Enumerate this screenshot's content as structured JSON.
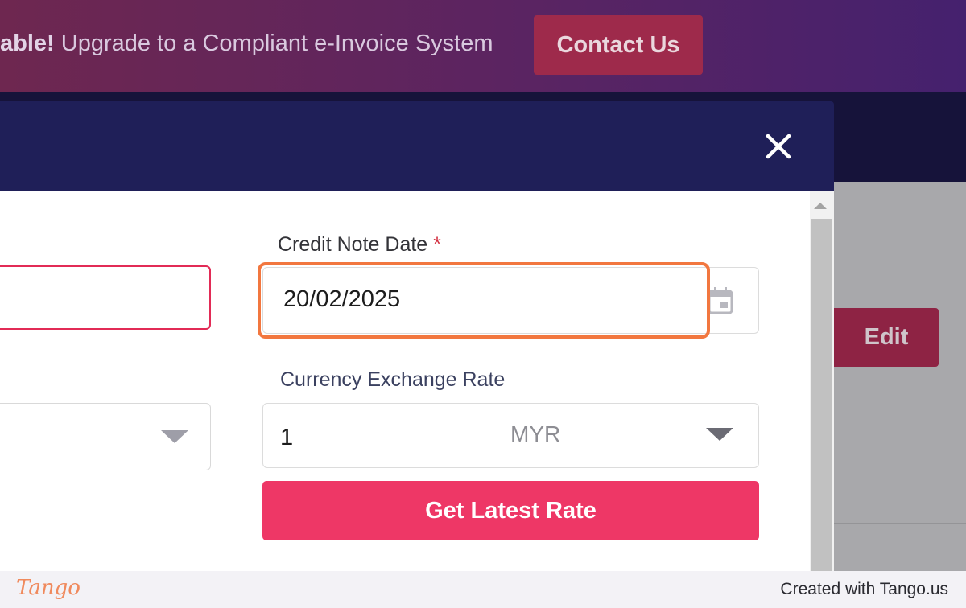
{
  "banner": {
    "text_bold": "able!",
    "text_rest": " Upgrade to a Compliant e-Invoice System",
    "contact_label": "Contact Us"
  },
  "background": {
    "edit_label": "Edit"
  },
  "modal": {
    "close_icon": "close-icon",
    "credit_note_date_label": "Credit Note Date",
    "required_mark": "*",
    "credit_note_date_value": "20/02/2025",
    "calendar_icon": "calendar-icon",
    "currency_exchange_rate_label": "Currency Exchange Rate",
    "exchange_rate_value": "1",
    "currency": "MYR",
    "get_latest_rate_label": "Get Latest Rate"
  },
  "footer": {
    "logo": "Tango",
    "credit": "Created with Tango.us"
  },
  "colors": {
    "accent": "#ee3766",
    "highlight": "#f2773f",
    "modal_header": "#1f1f58"
  }
}
